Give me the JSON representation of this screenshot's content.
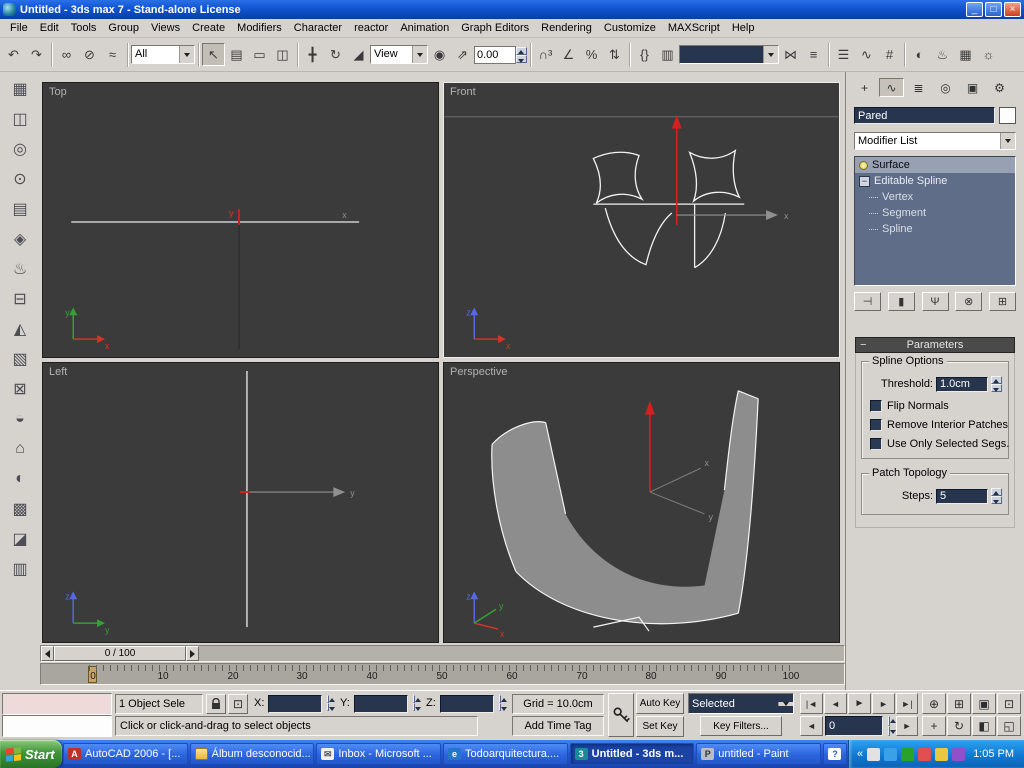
{
  "window": {
    "title": "Untitled - 3ds max 7  - Stand-alone License"
  },
  "menu": {
    "items": [
      "File",
      "Edit",
      "Tools",
      "Group",
      "Views",
      "Create",
      "Modifiers",
      "Character",
      "reactor",
      "Animation",
      "Graph Editors",
      "Rendering",
      "Customize",
      "MAXScript",
      "Help"
    ]
  },
  "toolbar": {
    "selection_filter": "All",
    "coord_system": "View",
    "spinner_value": "0.00",
    "named_selection": ""
  },
  "viewports": {
    "top": "Top",
    "front": "Front",
    "left": "Left",
    "perspective": "Perspective"
  },
  "axis": {
    "x": "x",
    "y": "y",
    "z": "z"
  },
  "command_panel": {
    "object_name": "Pared",
    "modifier_list": "Modifier List",
    "stack": {
      "surface": "Surface",
      "editable_spline": "Editable Spline",
      "vertex": "Vertex",
      "segment": "Segment",
      "spline": "Spline"
    },
    "parameters": {
      "title": "Parameters",
      "spline_options": "Spline Options",
      "threshold_label": "Threshold:",
      "threshold_value": "1.0cm",
      "flip_normals": "Flip Normals",
      "flip_normals_checked": false,
      "remove_interior": "Remove Interior Patches",
      "remove_interior_checked": false,
      "use_selected": "Use Only Selected Segs.",
      "use_selected_checked": false,
      "patch_topology": "Patch Topology",
      "steps_label": "Steps:",
      "steps_value": "5"
    }
  },
  "timeline": {
    "slider": "0 / 100",
    "ticks": [
      "0",
      "10",
      "20",
      "30",
      "40",
      "50",
      "60",
      "70",
      "80",
      "90",
      "100"
    ]
  },
  "status": {
    "selection": "1 Object Sele",
    "x": "X:",
    "y": "Y:",
    "z": "Z:",
    "grid": "Grid = 10.0cm",
    "prompt": "Click or click-and-drag to select objects",
    "add_time_tag": "Add Time Tag",
    "auto_key": "Auto Key",
    "set_key": "Set Key",
    "key_mode": "Selected",
    "key_filters": "Key Filters...",
    "time": "0"
  },
  "taskbar": {
    "start": "Start",
    "clock": "1:05 PM",
    "tasks": [
      {
        "label": "AutoCAD 2006 - [...",
        "glyph": "A"
      },
      {
        "label": "Álbum desconocid...",
        "glyph": ""
      },
      {
        "label": "Inbox - Microsoft ...",
        "glyph": "✉"
      },
      {
        "label": "Todoarquitectura....",
        "glyph": "e"
      },
      {
        "label": "Untitled - 3ds m...",
        "glyph": "3"
      },
      {
        "label": "untitled - Paint",
        "glyph": "P"
      },
      {
        "label": "",
        "glyph": "?"
      }
    ]
  },
  "reactor_icons": [
    "▦",
    "◫",
    "◎",
    "⊙",
    "▤",
    "◈",
    "♨",
    "⊟",
    "◭",
    "▧",
    "⊠",
    "◒",
    "⌂",
    "◐",
    "▩",
    "◪",
    "▥"
  ],
  "icons": {
    "min": "_",
    "max": "□",
    "close": "×",
    "undo": "↶",
    "redo": "↷",
    "link": "∞",
    "unlink": "⊘",
    "bind": "≈",
    "select": "↖",
    "select_by_name": "▤",
    "region": "▭",
    "crossing": "◫",
    "move": "╋",
    "rotate": "↻",
    "scale": "◢",
    "use_center": "◉",
    "manipulate": "⇗",
    "kbd": "{}",
    "snap3": "∩³",
    "angle": "∠",
    "percent": "%",
    "spin_snap": "⇅",
    "edit_named": "▥",
    "mirror": "⋈",
    "align": "≡",
    "layers": "☰",
    "curve": "∿",
    "schematic": "#",
    "material": "◐",
    "render": "♨",
    "rtype": "▦",
    "qrender": "☼",
    "tab_create": "+",
    "tab_modify": "∿",
    "tab_hier": "≣",
    "tab_motion": "◎",
    "tab_display": "▣",
    "tab_util": "⚙",
    "pin": "⊣",
    "show_end": "▮",
    "unique": "Ψ",
    "remove_mod": "⊗",
    "config_mod": "⊞",
    "collapse": "−",
    "abs_mode": "⊡",
    "go_start": "|◄",
    "prev": "◄",
    "play": "►",
    "next": "►",
    "go_end": "►|",
    "prev_key": "◄",
    "next_key": "►",
    "zoom": "⊕",
    "zoom_all": "⊞",
    "extents": "▣",
    "extents_all": "⊡",
    "pan": "+",
    "arc": "↻",
    "region_zoom": "◧",
    "minmax": "◱",
    "chevron": "«"
  }
}
